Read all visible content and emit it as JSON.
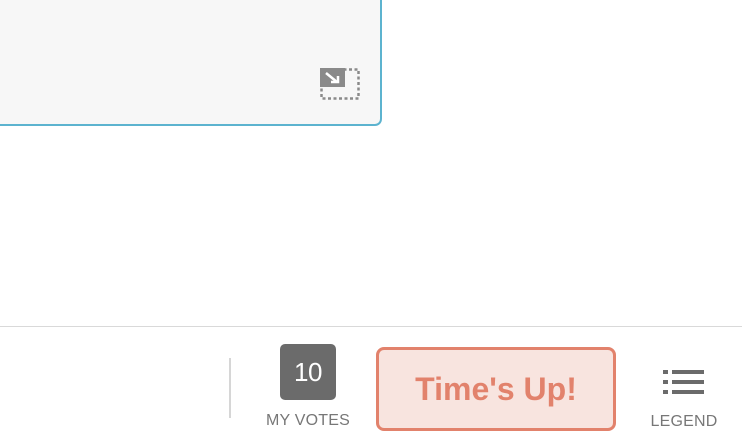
{
  "colors": {
    "card_border": "#5cb3cf",
    "card_bg": "#f7f7f7",
    "votes_badge_bg": "#6b6b6b",
    "timesup_text": "#e2826c",
    "timesup_bg": "#f8e4df",
    "label_gray": "#777777"
  },
  "card": {
    "expand_icon": "expand-icon"
  },
  "bottom_bar": {
    "my_votes": {
      "count": "10",
      "label": "MY VOTES"
    },
    "times_up": {
      "label": "Time's Up!"
    },
    "legend": {
      "icon": "list-icon",
      "label": "LEGEND"
    }
  }
}
